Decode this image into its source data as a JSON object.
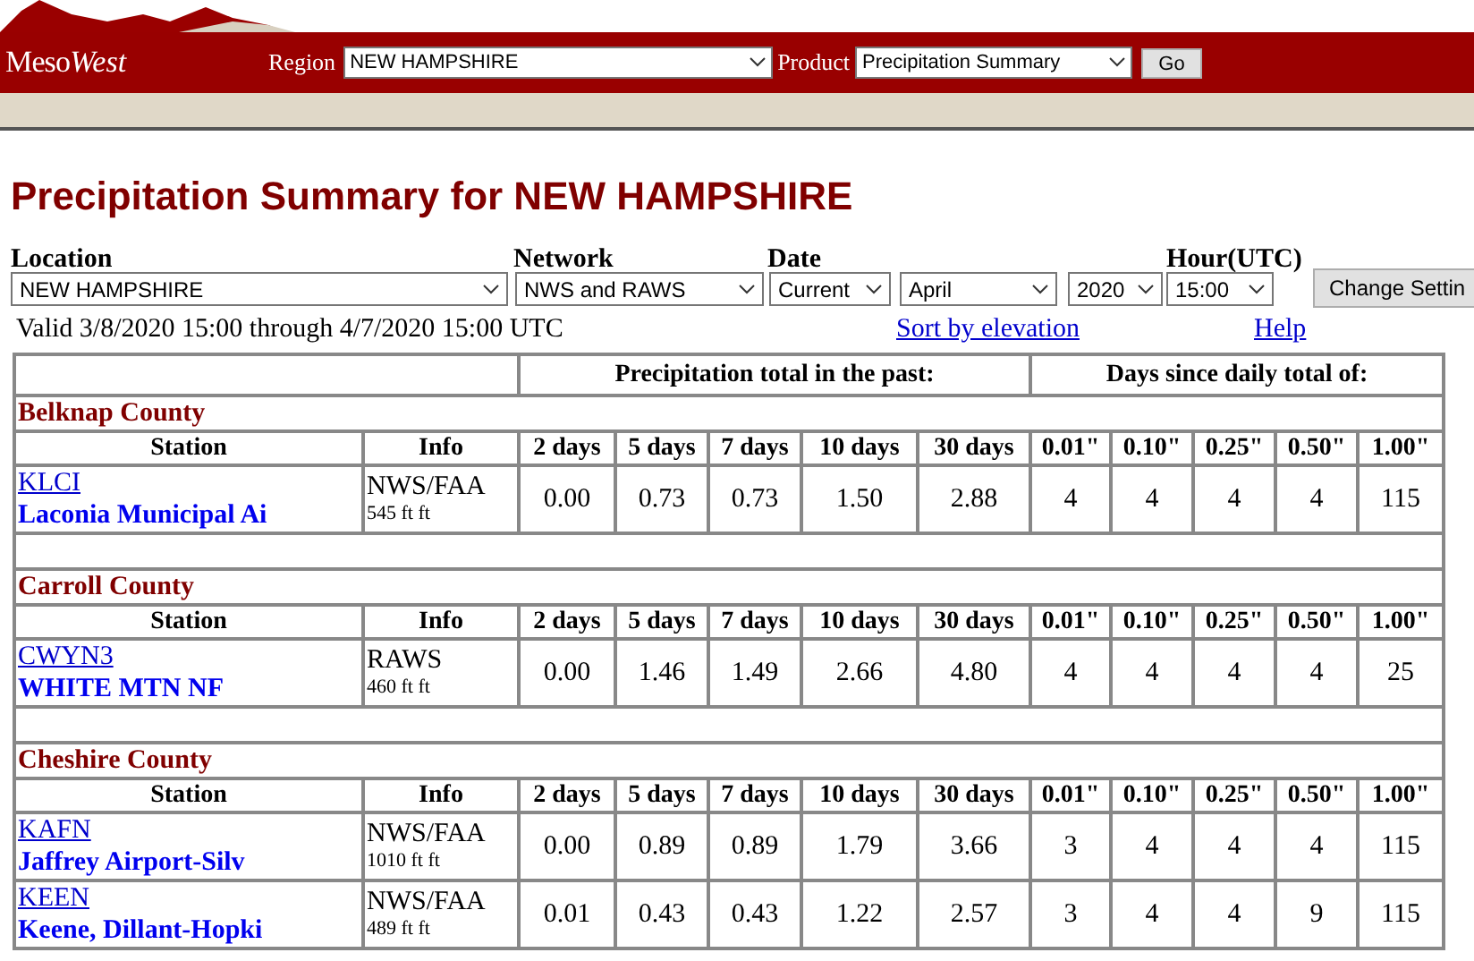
{
  "header": {
    "logo_left": "Meso",
    "logo_right": "West",
    "region_label": "Region",
    "region_value": "NEW HAMPSHIRE",
    "product_label": "Product",
    "product_value": "Precipitation Summary",
    "go_button": "Go"
  },
  "title": "Precipitation Summary for NEW HAMPSHIRE",
  "settings": {
    "labels": [
      {
        "text": "Location"
      },
      {
        "text": "Network"
      },
      {
        "text": "Date"
      },
      {
        "text": "Hour(UTC)"
      }
    ],
    "selects": [
      {
        "value": "NEW HAMPSHIRE"
      },
      {
        "value": "NWS and RAWS"
      },
      {
        "value": "Current"
      },
      {
        "value": "April"
      },
      {
        "value": "2020"
      },
      {
        "value": "15:00"
      }
    ],
    "button": "Change Settin"
  },
  "valid_text": "Valid 3/8/2020 15:00 through 4/7/2020 15:00 UTC",
  "links": [
    "Sort by elevation",
    "Help"
  ],
  "table": {
    "group_headers": [
      "Precipitation total in the past:",
      "Days since daily total of:"
    ],
    "counties": [
      {
        "name": "Belknap County",
        "columns": [
          "Station",
          "Info",
          "2 days",
          "5 days",
          "7 days",
          "10 days",
          "30 days",
          "0.01\"",
          "0.10\"",
          "0.25\"",
          "0.50\"",
          "1.00\""
        ],
        "stations": [
          {
            "id": "KLCI",
            "name": "Laconia Municipal Ai",
            "network": "NWS/FAA",
            "elevation": "545 ft ft",
            "values": [
              "0.00",
              "0.73",
              "0.73",
              "1.50",
              "2.88",
              "4",
              "4",
              "4",
              "4",
              "115"
            ]
          }
        ]
      },
      {
        "name": "Carroll County",
        "columns": [
          "Station",
          "Info",
          "2 days",
          "5 days",
          "7 days",
          "10 days",
          "30 days",
          "0.01\"",
          "0.10\"",
          "0.25\"",
          "0.50\"",
          "1.00\""
        ],
        "stations": [
          {
            "id": "CWYN3",
            "name": "WHITE MTN NF",
            "network": "RAWS",
            "elevation": "460 ft ft",
            "values": [
              "0.00",
              "1.46",
              "1.49",
              "2.66",
              "4.80",
              "4",
              "4",
              "4",
              "4",
              "25"
            ]
          }
        ]
      },
      {
        "name": "Cheshire County",
        "columns": [
          "Station",
          "Info",
          "2 days",
          "5 days",
          "7 days",
          "10 days",
          "30 days",
          "0.01\"",
          "0.10\"",
          "0.25\"",
          "0.50\"",
          "1.00\""
        ],
        "stations": [
          {
            "id": "KAFN",
            "name": "Jaffrey Airport-Silv",
            "network": "NWS/FAA",
            "elevation": "1010 ft ft",
            "values": [
              "0.00",
              "0.89",
              "0.89",
              "1.79",
              "3.66",
              "3",
              "4",
              "4",
              "4",
              "115"
            ]
          },
          {
            "id": "KEEN",
            "name": "Keene, Dillant-Hopki",
            "network": "NWS/FAA",
            "elevation": "489 ft ft",
            "values": [
              "0.01",
              "0.43",
              "0.43",
              "1.22",
              "2.57",
              "3",
              "4",
              "4",
              "9",
              "115"
            ]
          }
        ]
      }
    ]
  }
}
